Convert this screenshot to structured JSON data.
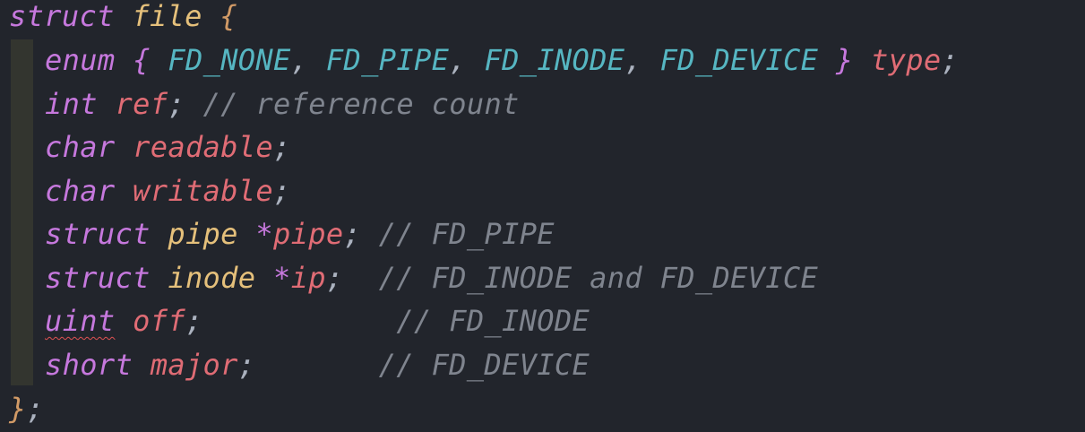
{
  "colors": {
    "background": "#22252c",
    "keyword": "#c678dd",
    "type": "#e5c07b",
    "enum_constant": "#56b6c2",
    "identifier": "#e06c75",
    "punctuation": "#abb2bf",
    "brace": "#d19a66",
    "comment": "#7f848e",
    "error_underline": "#e05252"
  },
  "code": {
    "l1": {
      "kw": "struct",
      "name": "file",
      "brace": "{"
    },
    "l2": {
      "kw": "enum",
      "brace_open": "{",
      "c1": "FD_NONE",
      "c2": "FD_PIPE",
      "c3": "FD_INODE",
      "c4": "FD_DEVICE",
      "comma": ",",
      "brace_close": "}",
      "name": "type",
      "semi": ";"
    },
    "l3": {
      "kw": "int",
      "name": "ref",
      "semi": ";",
      "comment": "// reference count"
    },
    "l4": {
      "kw": "char",
      "name": "readable",
      "semi": ";"
    },
    "l5": {
      "kw": "char",
      "name": "writable",
      "semi": ";"
    },
    "l6": {
      "kw": "struct",
      "type": "pipe",
      "star": "*",
      "name": "pipe",
      "semi": ";",
      "comment": "// FD_PIPE"
    },
    "l7": {
      "kw": "struct",
      "type": "inode",
      "star": "*",
      "name": "ip",
      "semi": ";",
      "comment": "// FD_INODE and FD_DEVICE"
    },
    "l8": {
      "kw": "uint",
      "name": "off",
      "semi": ";",
      "comment": "// FD_INODE"
    },
    "l9": {
      "kw": "short",
      "name": "major",
      "semi": ";",
      "comment": "// FD_DEVICE"
    },
    "l10": {
      "brace": "}",
      "semi": ";"
    }
  }
}
